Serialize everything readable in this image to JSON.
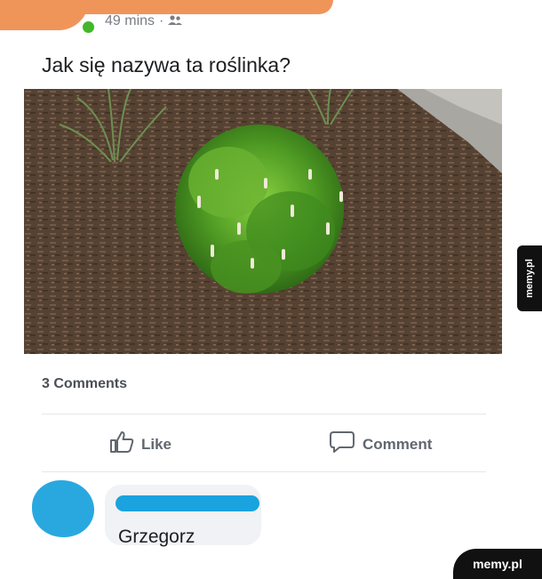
{
  "post": {
    "time": "49 mins",
    "separator": "·",
    "audience_icon": "friends-icon",
    "text": "Jak się nazywa ta roślinka?",
    "image_subject": "shrub-photo"
  },
  "stats": {
    "comments": "3 Comments"
  },
  "actions": {
    "like_label": "Like",
    "comment_label": "Comment"
  },
  "comment": {
    "text": "Grzegorz"
  },
  "watermark": {
    "side": "memy.pl",
    "corner": "memy.pl"
  },
  "colors": {
    "redact_orange": "#f0955a",
    "redact_blue": "#1aa3df",
    "online": "#42b72a"
  }
}
